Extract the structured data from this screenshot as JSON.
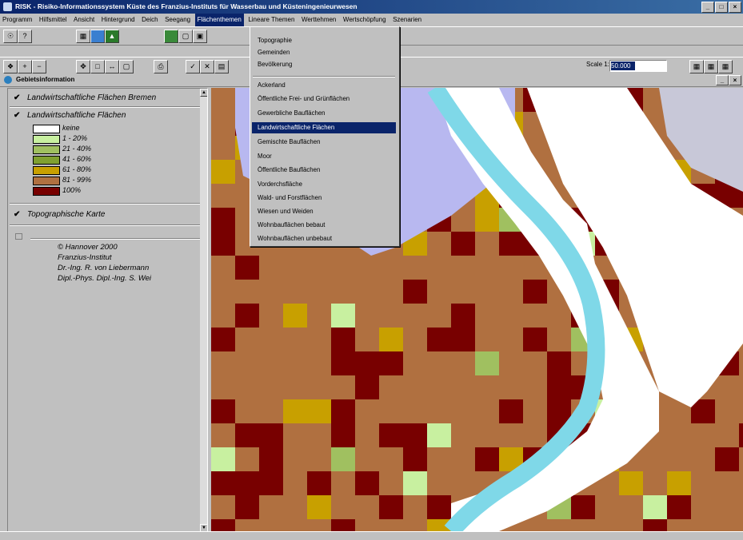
{
  "window": {
    "title": "RISK - Risiko-Informationssystem Küste des Franzius-Instituts für Wasserbau und Küsteningenieurwesen",
    "buttons": [
      "_",
      "□",
      "×"
    ]
  },
  "menubar": {
    "items": [
      "Programm",
      "Hilfsmittel",
      "Ansicht",
      "Hintergrund",
      "Deich",
      "Seegang",
      "Flächenthemen",
      "Lineare Themen",
      "Werttehmen",
      "Wertschöpfung",
      "Szenarien"
    ],
    "active_index": 6
  },
  "toolbar": {
    "scale_label": "Scale 1:",
    "scale_value": "50.000"
  },
  "info_panel": {
    "title": "Gebietsinformation"
  },
  "legend": {
    "layers": [
      {
        "label": "Landwirtschaftliche Flächen Bremen",
        "checked": true
      },
      {
        "label": "Landwirtschaftliche Flächen",
        "checked": true
      },
      {
        "label": "Topographische Karte",
        "checked": true
      }
    ],
    "classes": [
      {
        "label": "keine",
        "color": "#ffffff"
      },
      {
        "label": "1 - 20%",
        "color": "#c8f0a0"
      },
      {
        "label": "21 - 40%",
        "color": "#a0c060"
      },
      {
        "label": "41 - 60%",
        "color": "#80a030"
      },
      {
        "label": "61 - 80%",
        "color": "#c8a000"
      },
      {
        "label": "81 - 99%",
        "color": "#b07040"
      },
      {
        "label": "100%",
        "color": "#780000"
      }
    ],
    "credits": [
      "© Hannover 2000",
      "Franzius-Institut",
      "Dr.-Ing. R. von Liebermann",
      "Dipl.-Phys. Dipl.-Ing. S. Wei"
    ]
  },
  "dropdown": {
    "items": [
      "Topographie",
      "Gemeinden",
      "Bevölkerung",
      "Ackerland",
      "Öffentliche Frei- und Grünflächen",
      "Gewerbliche Bauflächen",
      "Landwirtschaftliche Flächen",
      "Gemischte Bauflächen",
      "Moor",
      "Öffentliche Bauflächen",
      "Vorderchsfläche",
      "Wald- und Forstflächen",
      "Wiesen und Weiden",
      "Wohnbauflächen bebaut",
      "Wohnbauflächen unbebaut"
    ],
    "highlighted_index": 6
  },
  "colors": {
    "title_bar": "#0a246a",
    "river": "#7fd8e8",
    "water_area": "#b8b8f0",
    "highlight": "#0a246a"
  }
}
